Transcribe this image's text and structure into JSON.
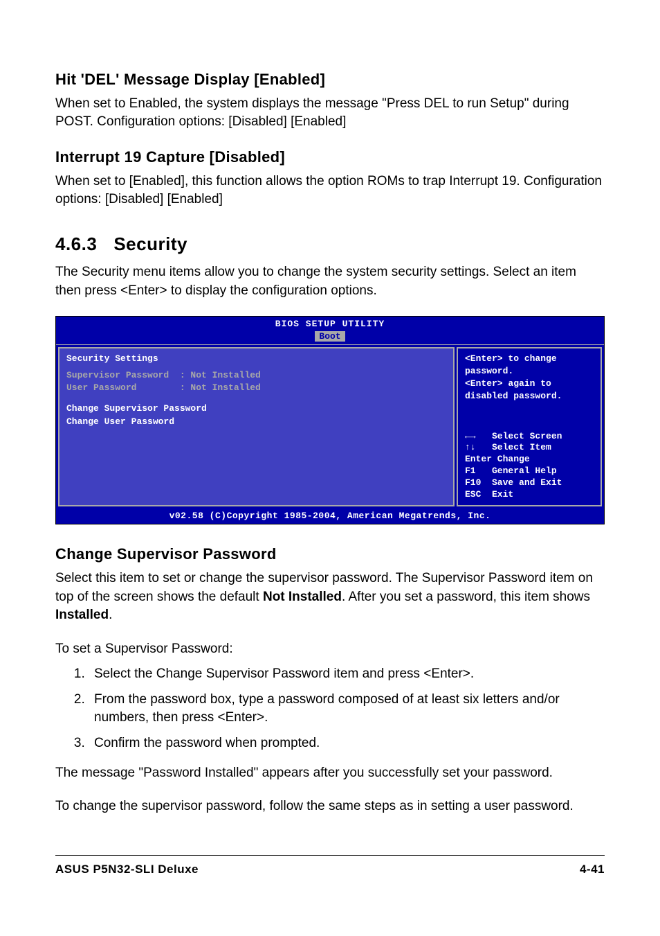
{
  "option1": {
    "title": "Hit 'DEL' Message Display [Enabled]",
    "desc": "When set to Enabled, the system displays the message \"Press DEL to run Setup\" during POST. Configuration options: [Disabled] [Enabled]"
  },
  "option2": {
    "title": "Interrupt 19 Capture [Disabled]",
    "desc": "When set to [Enabled], this function allows the option ROMs to trap Interrupt 19. Configuration options: [Disabled] [Enabled]"
  },
  "section": {
    "number": "4.6.3",
    "title": "Security",
    "desc": "The Security menu items allow you to change the system security settings. Select an item then press <Enter> to display the configuration options."
  },
  "bios": {
    "title": "BIOS SETUP UTILITY",
    "tab": "Boot",
    "left_title": "Security Settings",
    "field1": "Supervisor Password  : Not Installed",
    "field2": "User Password        : Not Installed",
    "action1": "Change Supervisor Password",
    "action2": "Change User Password",
    "help_top": "<Enter> to change\npassword.\n<Enter> again to\ndisabled password.",
    "nav": "←→   Select Screen\n↑↓   Select Item\nEnter Change\nF1   General Help\nF10  Save and Exit\nESC  Exit",
    "footer": "v02.58 (C)Copyright 1985-2004, American Megatrends, Inc."
  },
  "change_sup": {
    "title": "Change Supervisor Password",
    "para1_a": "Select this item to set or change the supervisor password. The Supervisor Password item on top of the screen shows the default ",
    "para1_bold1": "Not Installed",
    "para1_b": ". After you set a password, this item shows ",
    "para1_bold2": "Installed",
    "para1_c": ".",
    "para2": "To set a Supervisor Password:",
    "steps": [
      "Select the Change Supervisor Password item and press <Enter>.",
      "From the password box, type a password composed of at least six letters and/or numbers, then press <Enter>.",
      "Confirm the password when prompted."
    ],
    "para3": "The message \"Password Installed\" appears after you successfully set your password.",
    "para4": "To change the supervisor password, follow the same steps as in setting a user password."
  },
  "footer": {
    "left": "ASUS P5N32-SLI Deluxe",
    "right": "4-41"
  },
  "chart_data": {
    "type": "table",
    "title": "BIOS Security Settings",
    "rows": [
      {
        "field": "Supervisor Password",
        "value": "Not Installed"
      },
      {
        "field": "User Password",
        "value": "Not Installed"
      }
    ],
    "actions": [
      "Change Supervisor Password",
      "Change User Password"
    ],
    "help": "<Enter> to change password. <Enter> again to disabled password.",
    "navigation": [
      {
        "key": "←→",
        "action": "Select Screen"
      },
      {
        "key": "↑↓",
        "action": "Select Item"
      },
      {
        "key": "Enter",
        "action": "Change"
      },
      {
        "key": "F1",
        "action": "General Help"
      },
      {
        "key": "F10",
        "action": "Save and Exit"
      },
      {
        "key": "ESC",
        "action": "Exit"
      }
    ]
  }
}
